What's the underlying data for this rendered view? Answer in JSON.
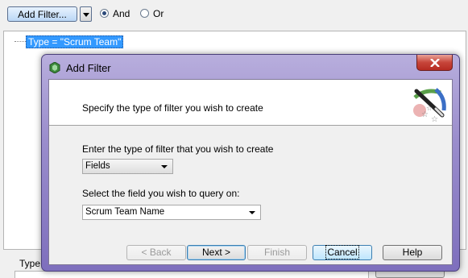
{
  "toolbar": {
    "add_filter_label": "Add Filter...",
    "radio_and_label": "And",
    "radio_or_label": "Or",
    "selected_logic": "And"
  },
  "tree": {
    "nodes": [
      {
        "label": "Type = \"Scrum Team\""
      }
    ]
  },
  "background": {
    "bottom_label": "Type"
  },
  "dialog": {
    "title": "Add Filter",
    "header_text": "Specify the type of filter you wish to create",
    "filter_type_label": "Enter the type of filter that you wish to create",
    "filter_type_value": "Fields",
    "field_label": "Select the field you wish to query on:",
    "field_value": "Scrum Team Name",
    "buttons": {
      "back": "< Back",
      "next": "Next >",
      "finish": "Finish",
      "cancel": "Cancel",
      "help": "Help"
    }
  },
  "colors": {
    "title_bar": "#9a8dcc",
    "selection": "#3399ff",
    "close_button": "#c7453a"
  }
}
